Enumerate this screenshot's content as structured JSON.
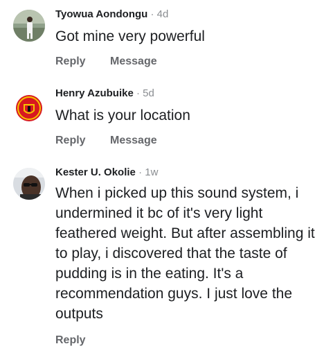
{
  "comments": [
    {
      "name": "Tyowua Aondongu",
      "separator": "·",
      "time": "4d",
      "text": "Got mine very powerful",
      "actions": {
        "reply": "Reply",
        "message": "Message"
      },
      "avatar": "person-photo-icon"
    },
    {
      "name": "Henry Azubuike",
      "separator": "·",
      "time": "5d",
      "text": "What is your location",
      "actions": {
        "reply": "Reply",
        "message": "Message"
      },
      "avatar": "club-crest-icon"
    },
    {
      "name": "Kester U. Okolie",
      "separator": "·",
      "time": "1w",
      "text": "When i picked up this sound system, i undermined it bc of it's very light feathered weight. But after assembling it to play, i discovered that the taste of pudding is in the eating. It's a recommendation guys. I just love the outputs",
      "actions": {
        "reply": "Reply"
      },
      "avatar": "person-sunglasses-photo-icon"
    }
  ],
  "colors": {
    "name": "#1c1e21",
    "meta": "#8a8d91",
    "action": "#65676b",
    "crest_red": "#d71920",
    "crest_gold": "#f5c400"
  }
}
